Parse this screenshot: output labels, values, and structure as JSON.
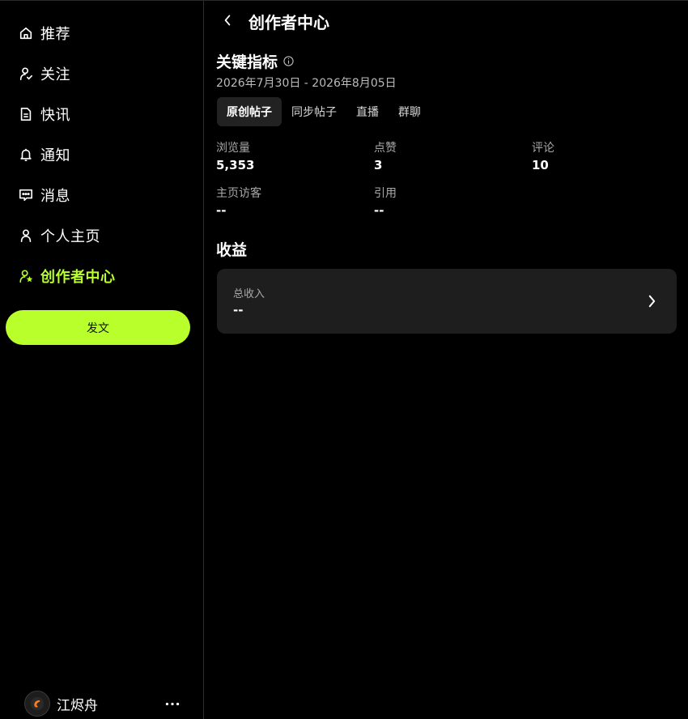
{
  "sidebar": {
    "items": [
      {
        "label": "推荐",
        "icon": "home-icon"
      },
      {
        "label": "关注",
        "icon": "user-follow-icon"
      },
      {
        "label": "快讯",
        "icon": "document-icon"
      },
      {
        "label": "通知",
        "icon": "bell-icon"
      },
      {
        "label": "消息",
        "icon": "chat-icon"
      },
      {
        "label": "个人主页",
        "icon": "profile-icon"
      },
      {
        "label": "创作者中心",
        "icon": "creator-icon",
        "active": true
      }
    ],
    "post_label": "发文",
    "user": {
      "name": "江烬舟",
      "avatar_icon": "avatar-icon"
    },
    "more_icon": "more-horizontal-icon"
  },
  "main": {
    "title": "创作者中心",
    "metrics_section": {
      "title": "关键指标",
      "date_range": "2026年7月30日 - 2026年8月05日",
      "tabs": [
        {
          "label": "原创帖子",
          "active": true
        },
        {
          "label": "同步帖子"
        },
        {
          "label": "直播"
        },
        {
          "label": "群聊"
        }
      ],
      "metrics": [
        {
          "label": "浏览量",
          "value": "5,353"
        },
        {
          "label": "点赞",
          "value": "3"
        },
        {
          "label": "评论",
          "value": "10"
        },
        {
          "label": "主页访客",
          "value": "--"
        },
        {
          "label": "引用",
          "value": "--"
        }
      ]
    },
    "income_section": {
      "title": "收益",
      "total_label": "总收入",
      "total_value": "--"
    }
  },
  "colors": {
    "accent": "#b8ff2c",
    "background": "#000000",
    "card": "#1e1e1e"
  }
}
